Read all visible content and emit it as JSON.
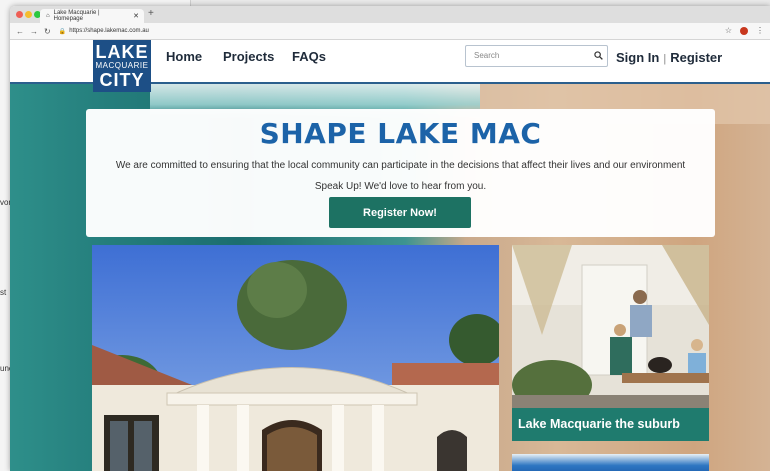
{
  "browser": {
    "tab_title": "Lake Macquarie | Homepage",
    "url": "https://shape.lakemac.com.au"
  },
  "background_window": {
    "fragments": [
      "vor",
      "st",
      "une"
    ]
  },
  "site": {
    "logo": {
      "line1": "LAKE",
      "line2": "MACQUARIE",
      "line3": "CITY"
    },
    "nav": [
      "Home",
      "Projects",
      "FAQs"
    ],
    "search_placeholder": "Search",
    "sign_in": "Sign In",
    "register": "Register",
    "colors": {
      "brand_blue": "#1c63a8",
      "logo_blue": "#1d4f86",
      "button_green": "#1d7263",
      "caption_green": "#1f7b6e"
    }
  },
  "hero": {
    "title": "SHAPE LAKE MAC",
    "subtitle": "We are committed to ensuring that the local community can participate in the decisions that affect their lives and our environment",
    "cta_text": "Speak Up! We'd love to hear from you.",
    "register_button": "Register Now!"
  },
  "cards": {
    "suburb_caption": "Lake Macquarie the suburb"
  }
}
